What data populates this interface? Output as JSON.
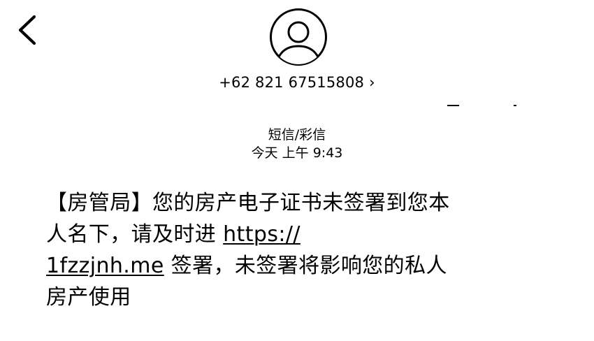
{
  "header": {
    "back_icon": "chevron-left-icon",
    "avatar_icon": "person-placeholder-icon",
    "contact_number": "+62 821 67515808",
    "contact_chevron": "›"
  },
  "conversation": {
    "message_type": "短信/彩信",
    "timestamp": "今天 上午 9:43"
  },
  "message": {
    "part1": "【房管局】您的房产电子证书未签署到您本人名下，请及时进 ",
    "link_line1": "https://",
    "link_line2": "1fzzjnh.me",
    "part2": " 签署，未签署将影响您的私人房产使用"
  },
  "colors": {
    "background": "#ffffff",
    "text": "#000000"
  }
}
